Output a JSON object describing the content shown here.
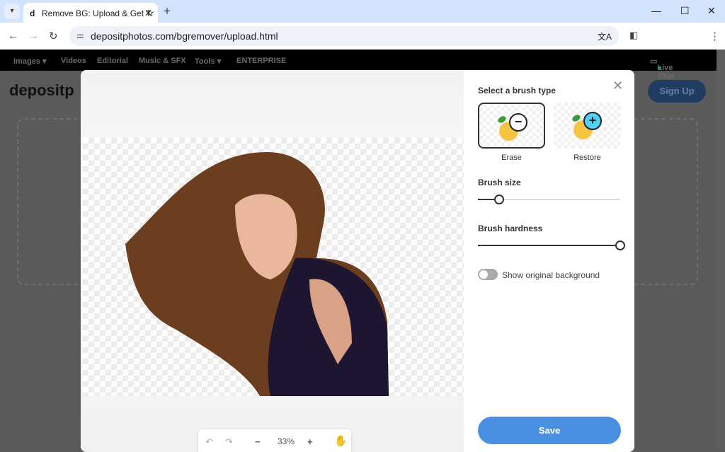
{
  "browser": {
    "tab_title": "Remove BG: Upload & Get Tr",
    "url": "depositphotos.com/bgremover/upload.html"
  },
  "site": {
    "nav": [
      "Images ▾",
      "Videos",
      "Editorial",
      "Music & SFX",
      "Tools ▾",
      "ENTERPRISE"
    ],
    "live_chat": "Live Chat",
    "logo": "depositp",
    "sign_up": "Sign Up"
  },
  "editor": {
    "zoom": "33%"
  },
  "panel": {
    "brush_type_heading": "Select a brush type",
    "brushes": [
      {
        "label": "Erase",
        "selected": true
      },
      {
        "label": "Restore",
        "selected": false
      }
    ],
    "brush_size_label": "Brush size",
    "brush_size": 0.15,
    "brush_hardness_label": "Brush hardness",
    "brush_hardness": 1.0,
    "toggle_label": "Show original background",
    "toggle_on": false,
    "save_label": "Save"
  },
  "colors": {
    "accent": "#4a90e2",
    "restore": "#4fd0f5"
  }
}
